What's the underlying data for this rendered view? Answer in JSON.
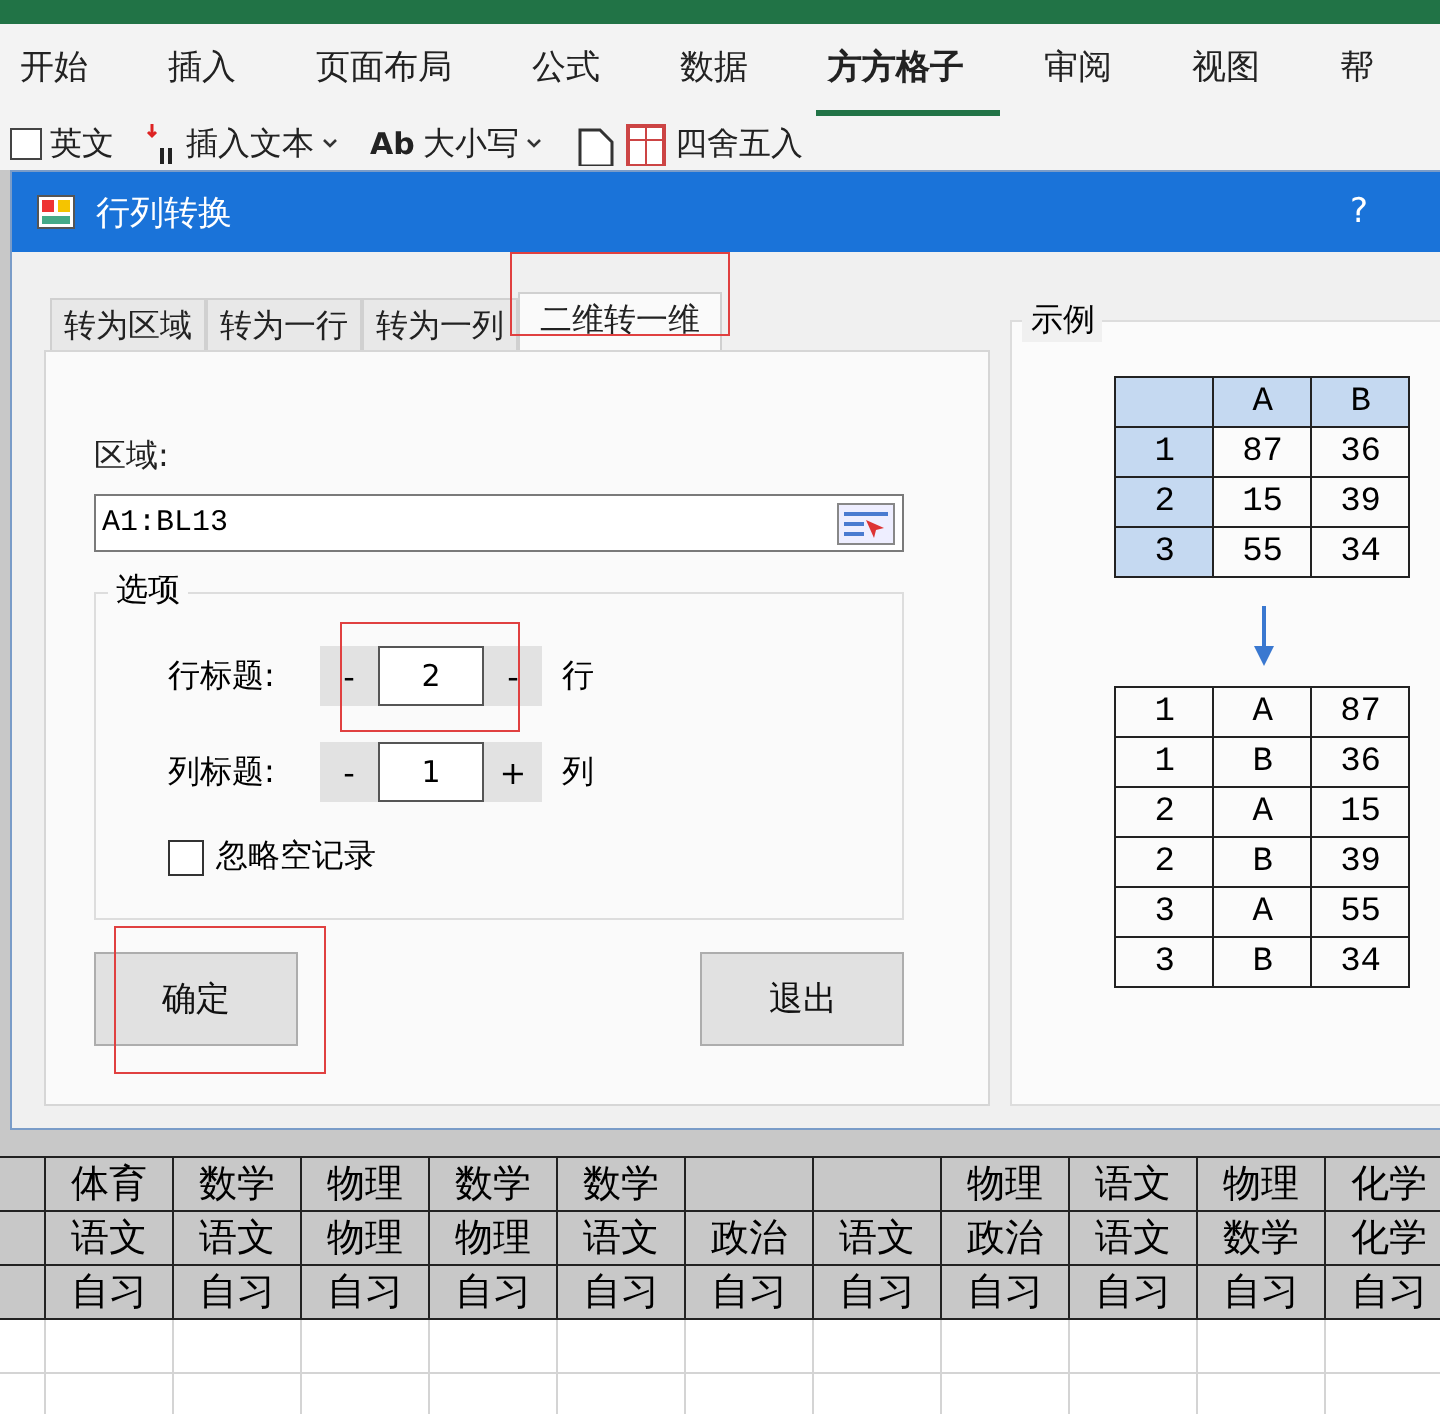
{
  "ribbon_tabs": [
    {
      "label": "开始",
      "selected": false
    },
    {
      "label": "插入",
      "selected": false
    },
    {
      "label": "页面布局",
      "selected": false
    },
    {
      "label": "公式",
      "selected": false
    },
    {
      "label": "数据",
      "selected": false
    },
    {
      "label": "方方格子",
      "selected": true
    },
    {
      "label": "审阅",
      "selected": false
    },
    {
      "label": "视图",
      "selected": false
    },
    {
      "label": "帮",
      "selected": false
    }
  ],
  "toolbar": [
    {
      "kind": "checkbox",
      "label": "英文",
      "checked": false
    },
    {
      "kind": "dropdown",
      "label": "插入文本"
    },
    {
      "kind": "dropdown",
      "icon_text": "Ab",
      "label": "大小写"
    },
    {
      "kind": "button",
      "label": "四舍五入"
    }
  ],
  "dialog": {
    "title": "行列转换",
    "help": "?",
    "tabs": [
      {
        "label": "转为区域",
        "selected": false,
        "highlighted": false
      },
      {
        "label": "转为一行",
        "selected": false,
        "highlighted": false
      },
      {
        "label": "转为一列",
        "selected": false,
        "highlighted": false
      },
      {
        "label": "二维转一维",
        "selected": true,
        "highlighted": true
      }
    ],
    "range_label": "区域:",
    "range_value": "A1:BL13",
    "options_title": "选项",
    "spinners": [
      {
        "label": "行标题:",
        "minus": "-",
        "value": "2",
        "plus": "-",
        "unit": "行",
        "highlighted": true
      },
      {
        "label": "列标题:",
        "minus": "-",
        "value": "1",
        "plus": "+",
        "unit": "列",
        "highlighted": false
      }
    ],
    "ignore_empty": {
      "label": "忽略空记录",
      "checked": false
    },
    "buttons": [
      {
        "label": "确定",
        "highlighted": true
      },
      {
        "label": "退出",
        "highlighted": false
      }
    ],
    "example": {
      "title": "示例",
      "source_header": [
        "A",
        "B"
      ],
      "source_rows": [
        [
          "1",
          "87",
          "36"
        ],
        [
          "2",
          "15",
          "39"
        ],
        [
          "3",
          "55",
          "34"
        ]
      ],
      "result_rows": [
        [
          "1",
          "A",
          "87"
        ],
        [
          "1",
          "B",
          "36"
        ],
        [
          "2",
          "A",
          "15"
        ],
        [
          "2",
          "B",
          "39"
        ],
        [
          "3",
          "A",
          "55"
        ],
        [
          "3",
          "B",
          "34"
        ]
      ]
    }
  },
  "sheet_rows": [
    [
      "体育",
      "数学",
      "物理",
      "数学",
      "数学",
      null,
      null,
      "物理",
      "语文",
      "物理",
      "化学"
    ],
    [
      "语文",
      "语文",
      "物理",
      "物理",
      "语文",
      "政治",
      "语文",
      "政治",
      "语文",
      "数学",
      "化学"
    ],
    [
      "自习",
      "自习",
      "自习",
      "自习",
      "自习",
      "自习",
      "自习",
      "自习",
      "自习",
      "自习",
      "自习"
    ]
  ]
}
